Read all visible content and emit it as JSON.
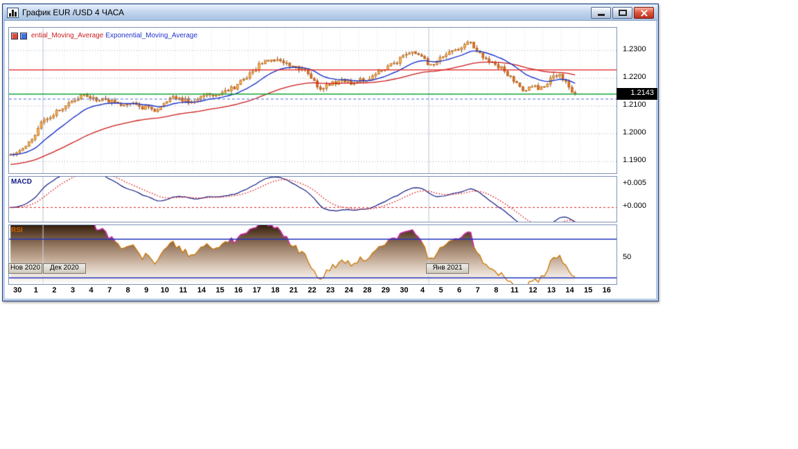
{
  "window": {
    "title": "График EUR /USD  4 ЧАСА"
  },
  "legend": {
    "red_label": "ential_Moving_Average",
    "blue_label": "Exponential_Moving_Average",
    "red_color": "#e14a3a",
    "blue_color": "#4070e0",
    "red_text_color": "#cc2020",
    "blue_text_color": "#2233cc"
  },
  "main_chart": {
    "current_price_label": "1.2143"
  },
  "macd_panel": {
    "label": "MACD"
  },
  "rsi_panel": {
    "label": "RSI"
  },
  "month_markers": [
    {
      "label": "Нов 2020"
    },
    {
      "label": "Дек 2020"
    },
    {
      "label": "Янв 2021"
    }
  ],
  "chart_data": {
    "type": "candlestick",
    "symbol": "EUR/USD",
    "timeframe": "4 hours",
    "x_labels": [
      "30",
      "1",
      "2",
      "3",
      "4",
      "7",
      "8",
      "9",
      "10",
      "11",
      "14",
      "15",
      "16",
      "17",
      "18",
      "21",
      "22",
      "23",
      "24",
      "28",
      "29",
      "30",
      "4",
      "5",
      "6",
      "7",
      "8",
      "11",
      "12",
      "13",
      "14",
      "15",
      "16"
    ],
    "candles_per_day": 6,
    "last_day_candles": 5,
    "start_price": 1.1925,
    "daily_closes": [
      1.1955,
      1.205,
      1.209,
      1.214,
      1.212,
      1.211,
      1.2105,
      1.208,
      1.2135,
      1.2115,
      1.214,
      1.2155,
      1.22,
      1.2265,
      1.2255,
      1.2235,
      1.216,
      1.219,
      1.2185,
      1.2215,
      1.2255,
      1.2295,
      1.225,
      1.2295,
      1.233,
      1.227,
      1.2225,
      1.2155,
      1.217,
      1.2215,
      1.2143,
      null,
      null
    ],
    "noise": 0.0012,
    "seed": 11,
    "ylim": [
      1.1858,
      1.2382
    ],
    "main_ticks": [
      {
        "v": 1.23,
        "label": "1.2300"
      },
      {
        "v": 1.22,
        "label": "1.2200"
      },
      {
        "v": 1.21,
        "label": "1.2100"
      },
      {
        "v": 1.2,
        "label": "1.2000"
      },
      {
        "v": 1.19,
        "label": "1.1900"
      }
    ],
    "current_price": {
      "value": 1.2143,
      "label": "1.2143"
    },
    "hlines": [
      {
        "value": 1.223,
        "color": "#e01818",
        "dash": null,
        "width": 1.2
      },
      {
        "value": 1.2143,
        "color": "#12a53a",
        "dash": null,
        "width": 1.4
      },
      {
        "value": 1.2125,
        "color": "#4466dd",
        "dash": [
          4,
          3
        ],
        "width": 1
      }
    ],
    "ema_fast": {
      "period": 16,
      "color": "#1830c8",
      "init": 1.1925
    },
    "ema_slow": {
      "period": 55,
      "color": "#cc1818",
      "init": 1.1888
    },
    "macd": {
      "fast": 10,
      "slow": 40,
      "signal": 9,
      "ylim": [
        -0.0031,
        0.0067
      ],
      "ticks": [
        {
          "v": 0.005,
          "label": "+0.005"
        },
        {
          "v": 0.0,
          "label": "+0.000"
        }
      ],
      "line_color": "#101880",
      "signal_color": "#dd2020",
      "zero_color": "#dd2020"
    },
    "rsi": {
      "period": 14,
      "ylim": [
        23.5,
        84.5
      ],
      "levels": [
        70,
        30
      ],
      "mid": {
        "v": 50,
        "label": "50"
      },
      "line_color": "#cc7700",
      "over_color": "#cc22cc",
      "level_color": "#2233bb"
    },
    "colors": {
      "up": "#ffb04a",
      "down": "#e06a22",
      "body_border": "#a85a10",
      "wick": "#8a4a10",
      "grid_h": "#98a0b4",
      "grid_v": "#d6dae6",
      "month_line": "#b6c0d2"
    },
    "month_separator_frac": [
      0.056,
      0.691
    ]
  }
}
